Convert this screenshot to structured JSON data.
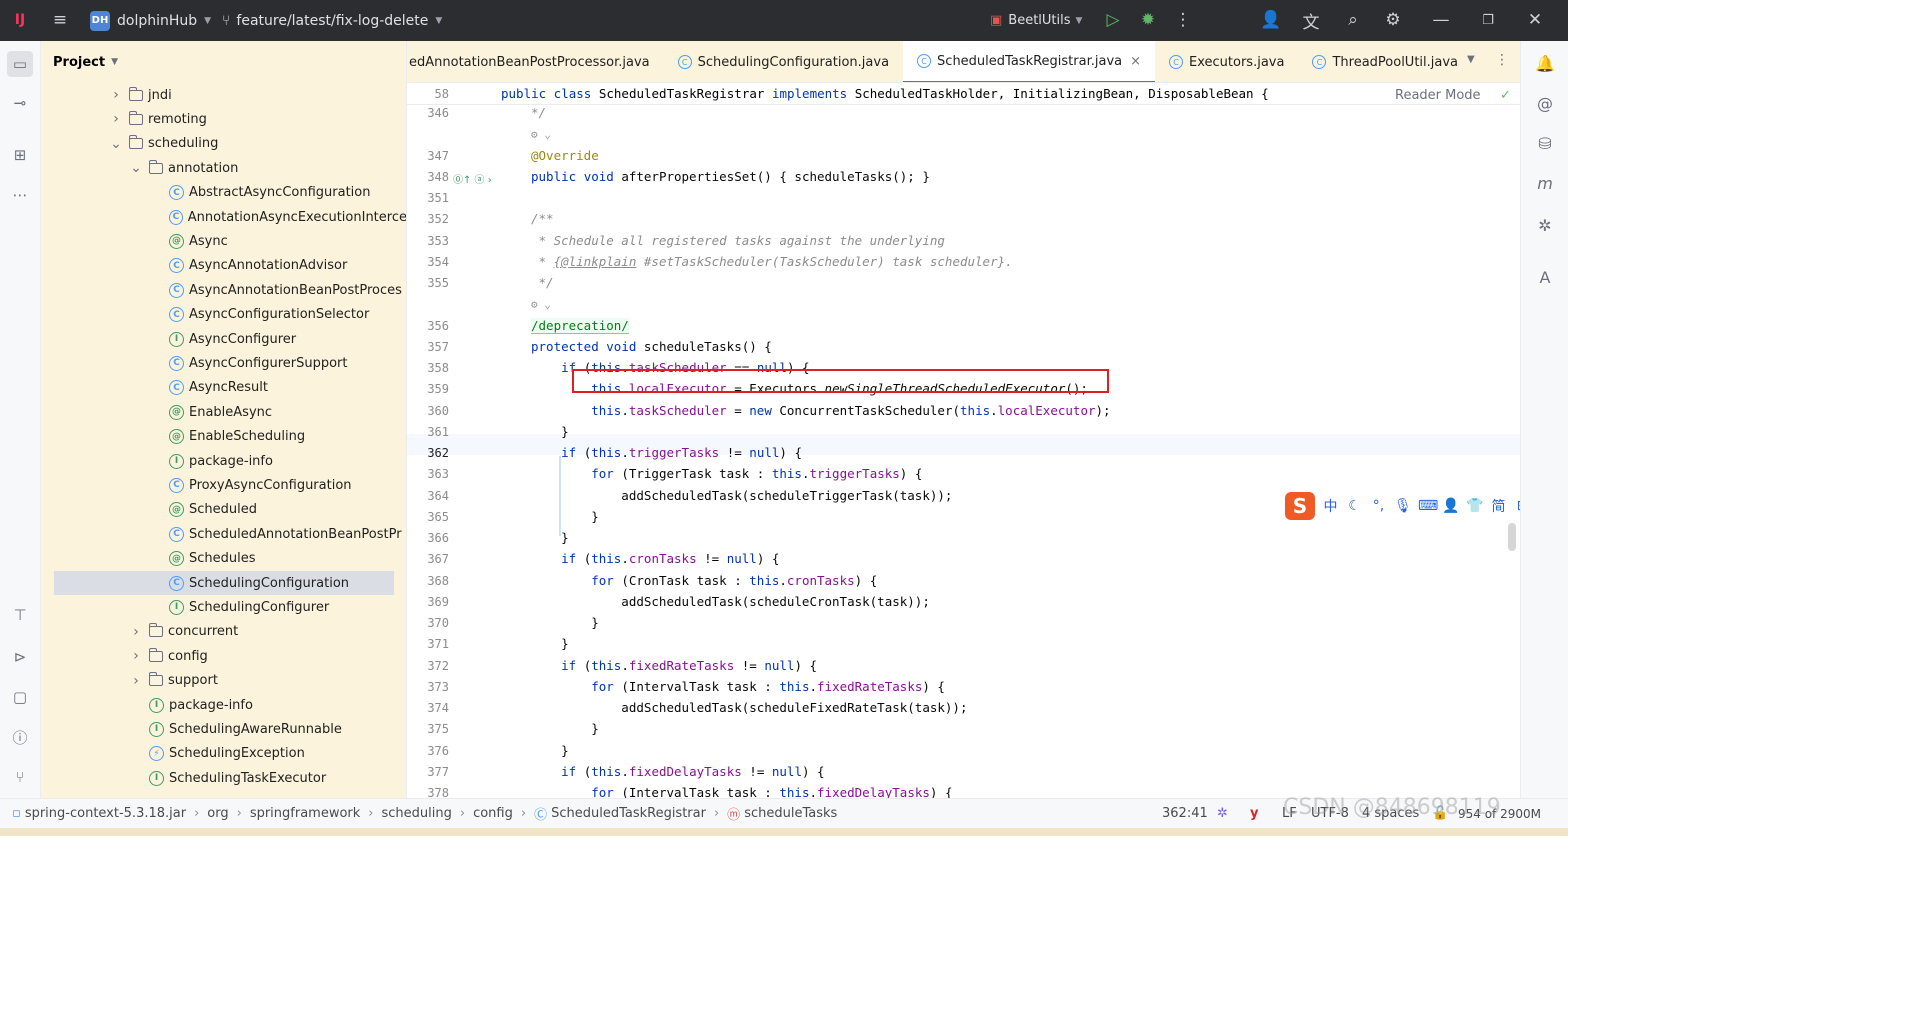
{
  "titlebar": {
    "project_badge": "DH",
    "project_name": "dolphinHub",
    "branch": "feature/latest/fix-log-delete",
    "run_config": "BeetlUtils"
  },
  "project_panel": {
    "title": "Project",
    "tree": [
      {
        "label": "jndi",
        "type": "folder",
        "expanded": false,
        "depth": 0
      },
      {
        "label": "remoting",
        "type": "folder",
        "expanded": false,
        "depth": 0
      },
      {
        "label": "scheduling",
        "type": "folder",
        "expanded": true,
        "depth": 0
      },
      {
        "label": "annotation",
        "type": "folder",
        "expanded": true,
        "depth": 1
      },
      {
        "label": "AbstractAsyncConfiguration",
        "type": "class",
        "glyph": "C",
        "depth": 2
      },
      {
        "label": "AnnotationAsyncExecutionInterce",
        "type": "class",
        "glyph": "C",
        "depth": 2
      },
      {
        "label": "Async",
        "type": "annotation",
        "glyph": "@",
        "depth": 2
      },
      {
        "label": "AsyncAnnotationAdvisor",
        "type": "class",
        "glyph": "C",
        "depth": 2
      },
      {
        "label": "AsyncAnnotationBeanPostProces",
        "type": "class",
        "glyph": "C",
        "depth": 2
      },
      {
        "label": "AsyncConfigurationSelector",
        "type": "class",
        "glyph": "C",
        "depth": 2
      },
      {
        "label": "AsyncConfigurer",
        "type": "interface",
        "glyph": "I",
        "depth": 2
      },
      {
        "label": "AsyncConfigurerSupport",
        "type": "class",
        "glyph": "C",
        "depth": 2
      },
      {
        "label": "AsyncResult",
        "type": "class",
        "glyph": "C",
        "depth": 2
      },
      {
        "label": "EnableAsync",
        "type": "annotation",
        "glyph": "@",
        "depth": 2
      },
      {
        "label": "EnableScheduling",
        "type": "annotation",
        "glyph": "@",
        "depth": 2
      },
      {
        "label": "package-info",
        "type": "interface",
        "glyph": "I",
        "depth": 2
      },
      {
        "label": "ProxyAsyncConfiguration",
        "type": "class",
        "glyph": "C",
        "depth": 2
      },
      {
        "label": "Scheduled",
        "type": "annotation",
        "glyph": "@",
        "depth": 2
      },
      {
        "label": "ScheduledAnnotationBeanPostPr",
        "type": "class",
        "glyph": "C",
        "depth": 2
      },
      {
        "label": "Schedules",
        "type": "annotation",
        "glyph": "@",
        "depth": 2
      },
      {
        "label": "SchedulingConfiguration",
        "type": "class",
        "glyph": "C",
        "depth": 2,
        "selected": true
      },
      {
        "label": "SchedulingConfigurer",
        "type": "interface",
        "glyph": "I",
        "depth": 2
      },
      {
        "label": "concurrent",
        "type": "folder",
        "expanded": false,
        "depth": 1
      },
      {
        "label": "config",
        "type": "folder",
        "expanded": false,
        "depth": 1
      },
      {
        "label": "support",
        "type": "folder",
        "expanded": false,
        "depth": 1
      },
      {
        "label": "package-info",
        "type": "interface",
        "glyph": "I",
        "depth": 1
      },
      {
        "label": "SchedulingAwareRunnable",
        "type": "interface",
        "glyph": "I",
        "depth": 1
      },
      {
        "label": "SchedulingException",
        "type": "exception",
        "glyph": "⚡",
        "depth": 1
      },
      {
        "label": "SchedulingTaskExecutor",
        "type": "interface",
        "glyph": "I",
        "depth": 1
      }
    ]
  },
  "tabs": [
    {
      "label": "edAnnotationBeanPostProcessor.java",
      "active": false
    },
    {
      "label": "SchedulingConfiguration.java",
      "active": false
    },
    {
      "label": "ScheduledTaskRegistrar.java",
      "active": true,
      "closable": true
    },
    {
      "label": "Executors.java",
      "active": false
    },
    {
      "label": "ThreadPoolUtil.java",
      "active": false
    }
  ],
  "editor": {
    "reader_mode_label": "Reader Mode",
    "sticky_line_number": "58",
    "sticky_code": "public class ScheduledTaskRegistrar implements ScheduledTaskHolder, InitializingBean, DisposableBean {",
    "lines": [
      {
        "n": "346",
        "code": "*/"
      },
      {
        "n": "",
        "code": "⚙"
      },
      {
        "n": "347",
        "code": "@Override"
      },
      {
        "n": "348",
        "code": "public void afterPropertiesSet() { scheduleTasks(); }"
      },
      {
        "n": "351",
        "code": ""
      },
      {
        "n": "352",
        "code": "/**"
      },
      {
        "n": "353",
        "code": " * Schedule all registered tasks against the underlying"
      },
      {
        "n": "354",
        "code": " * {@linkplain #setTaskScheduler(TaskScheduler) task scheduler}."
      },
      {
        "n": "355",
        "code": " */"
      },
      {
        "n": "",
        "code": "⚙"
      },
      {
        "n": "356",
        "code": "/deprecation/"
      },
      {
        "n": "357",
        "code": "protected void scheduleTasks() {"
      },
      {
        "n": "358",
        "code": "    if (this.taskScheduler == null) {"
      },
      {
        "n": "359",
        "code": "        this.localExecutor = Executors.newSingleThreadScheduledExecutor();"
      },
      {
        "n": "360",
        "code": "        this.taskScheduler = new ConcurrentTaskScheduler(this.localExecutor);"
      },
      {
        "n": "361",
        "code": "    }"
      },
      {
        "n": "362",
        "code": "    if (this.triggerTasks != null) {"
      },
      {
        "n": "363",
        "code": "        for (TriggerTask task : this.triggerTasks) {"
      },
      {
        "n": "364",
        "code": "            addScheduledTask(scheduleTriggerTask(task));"
      },
      {
        "n": "365",
        "code": "        }"
      },
      {
        "n": "366",
        "code": "    }"
      },
      {
        "n": "367",
        "code": "    if (this.cronTasks != null) {"
      },
      {
        "n": "368",
        "code": "        for (CronTask task : this.cronTasks) {"
      },
      {
        "n": "369",
        "code": "            addScheduledTask(scheduleCronTask(task));"
      },
      {
        "n": "370",
        "code": "        }"
      },
      {
        "n": "371",
        "code": "    }"
      },
      {
        "n": "372",
        "code": "    if (this.fixedRateTasks != null) {"
      },
      {
        "n": "373",
        "code": "        for (IntervalTask task : this.fixedRateTasks) {"
      },
      {
        "n": "374",
        "code": "            addScheduledTask(scheduleFixedRateTask(task));"
      },
      {
        "n": "375",
        "code": "        }"
      },
      {
        "n": "376",
        "code": "    }"
      },
      {
        "n": "377",
        "code": "    if (this.fixedDelayTasks != null) {"
      },
      {
        "n": "378",
        "code": "        for (IntervalTask task : this.fixedDelayTasks) {"
      }
    ]
  },
  "statusbar": {
    "breadcrumbs": [
      "spring-context-5.3.18.jar",
      "org",
      "springframework",
      "scheduling",
      "config",
      "ScheduledTaskRegistrar",
      "scheduleTasks"
    ],
    "position": "362:41",
    "line_separator": "LF",
    "encoding": "UTF-8",
    "indent": "4 spaces",
    "memory": "954 of 2900M",
    "watermark": "CSDN @848698119"
  },
  "ime_toolbar": {
    "mode": "中",
    "simplified": "简"
  },
  "colors": {
    "titlebar_bg": "#2b2d30",
    "project_bg": "#fbf3dc",
    "accent": "#3574f0",
    "keyword": "#0033b3",
    "field": "#871094",
    "highlight_box": "#e02020"
  }
}
